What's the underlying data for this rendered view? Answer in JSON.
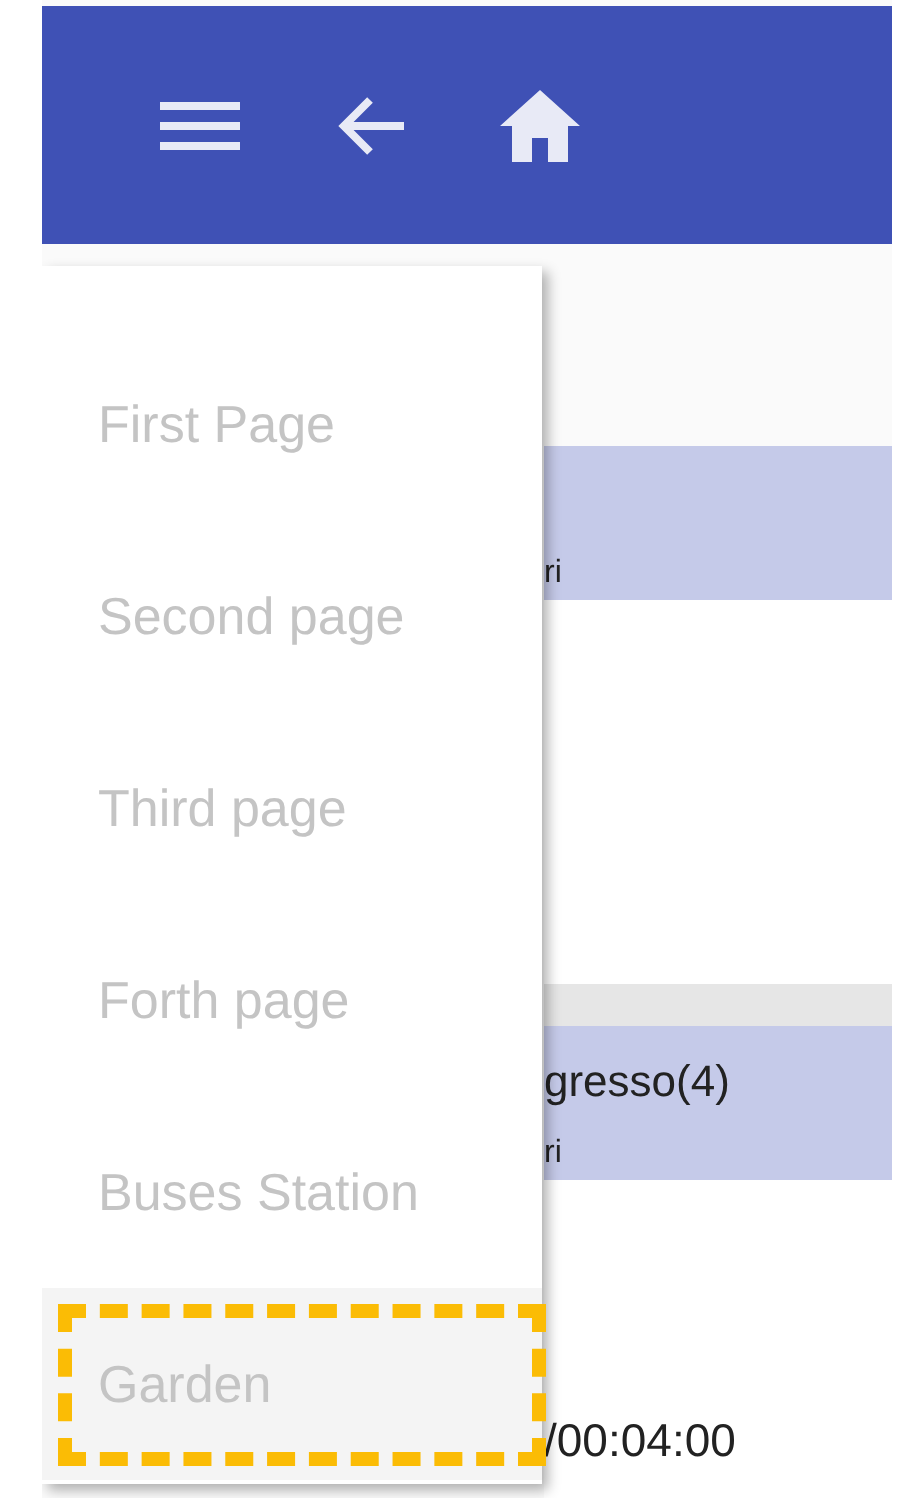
{
  "toolbar": {
    "buttons": [
      {
        "kind": "menu"
      },
      {
        "kind": "back"
      },
      {
        "kind": "home"
      }
    ]
  },
  "background": {
    "cards": [
      {
        "kind": "band",
        "subtitle": "ri"
      },
      {
        "kind": "plain"
      },
      {
        "kind": "divider"
      },
      {
        "kind": "band",
        "title": "gresso(4)",
        "subtitle": "ri"
      },
      {
        "kind": "time",
        "title": "/00:04:00"
      }
    ]
  },
  "menu": {
    "items": [
      {
        "label": "First Page",
        "selected": false
      },
      {
        "label": "Second page",
        "selected": false
      },
      {
        "label": "Third page",
        "selected": false
      },
      {
        "label": "Forth page",
        "selected": false
      },
      {
        "label": "Buses Station",
        "selected": false
      },
      {
        "label": "Garden",
        "selected": true
      }
    ]
  }
}
